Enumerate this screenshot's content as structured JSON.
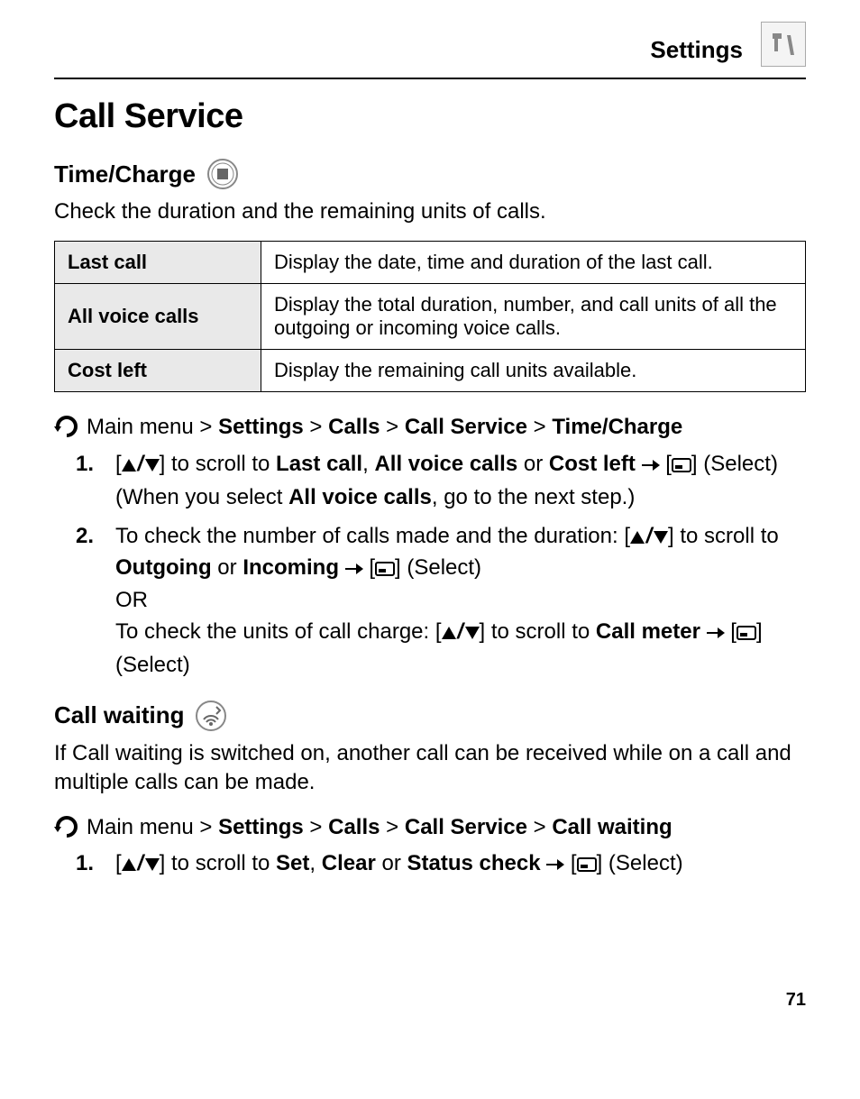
{
  "header": {
    "section": "Settings"
  },
  "title": "Call Service",
  "timeCharge": {
    "heading": "Time/Charge",
    "intro": "Check the duration and the remaining units of calls.",
    "rows": [
      {
        "label": "Last call",
        "desc": "Display the date, time and duration of the last call."
      },
      {
        "label": "All voice calls",
        "desc": "Display the total duration, number, and call units of all the outgoing or incoming voice calls."
      },
      {
        "label": "Cost left",
        "desc": "Display the remaining call units available."
      }
    ],
    "nav": {
      "pre": " Main menu > ",
      "p1": "Settings",
      "sep": " > ",
      "p2": "Calls",
      "p3": "Call Service",
      "p4": "Time/Charge"
    },
    "step1": {
      "a": "] to scroll to ",
      "b1": "Last call",
      "c": ", ",
      "b2": "All voice calls",
      "d": " or ",
      "b3": "Cost left",
      "selectLabel": "] (Select)",
      "note": "(When you select ",
      "noteBold": "All voice calls",
      "noteEnd": ", go to the next step.)"
    },
    "step2": {
      "lead": "To check the number of calls made and the duration: [",
      "mid": "] to scroll to ",
      "out": "Outgoing",
      "or": " or ",
      "inc": "Incoming",
      "sel": "] (Select)",
      "OR": "OR",
      "lead2": "To check the units of call charge: [",
      "mid2": "] to scroll to ",
      "meter": "Call meter",
      "sel2": "] (Select)"
    }
  },
  "callWaiting": {
    "heading": "Call waiting",
    "intro": "If Call waiting is switched on, another call can be received while on a call and multiple calls can be made.",
    "nav": {
      "pre": " Main menu > ",
      "p1": "Settings",
      "sep": " > ",
      "p2": "Calls",
      "p3": "Call Service",
      "p4": "Call waiting"
    },
    "step1": {
      "a": "] to scroll to ",
      "b1": "Set",
      "c": ", ",
      "b2": "Clear",
      "d": " or ",
      "b3": "Status check",
      "sel": "] (Select)"
    }
  },
  "pageNumber": "71"
}
